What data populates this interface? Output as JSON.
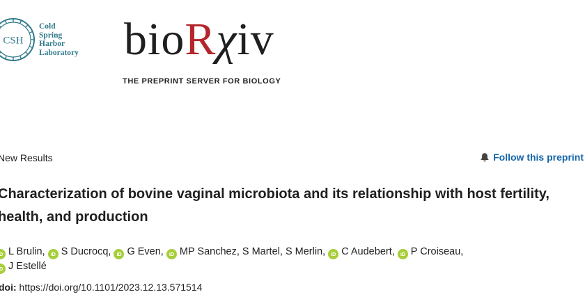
{
  "header": {
    "csh_logo": {
      "seal_text": "CSH",
      "lines": [
        "Cold",
        "Spring",
        "Harbor",
        "Laboratory"
      ]
    },
    "biorxiv_logo": {
      "part1": "bio",
      "part2": "R",
      "part3": "χ",
      "part4": "iv"
    },
    "tagline": "THE PREPRINT SERVER FOR BIOLOGY",
    "colors": {
      "teal": "#2f7a8c",
      "brand_red": "#b3262b",
      "link_blue": "#1565a8",
      "orcid_green": "#a6ce39"
    }
  },
  "article": {
    "category": "New Results",
    "follow_label": "Follow this preprint",
    "title": "Characterization of bovine vaginal microbiota and its relationship with host fertility, health, and production",
    "orcid_icon_text": "iD",
    "authors": [
      {
        "name": "L Brulin,",
        "orcid": true
      },
      {
        "name": "S Ducrocq,",
        "orcid": true
      },
      {
        "name": "G Even,",
        "orcid": true
      },
      {
        "name": "MP Sanchez,",
        "orcid": true
      },
      {
        "name": "S Martel,",
        "orcid": false
      },
      {
        "name": "S Merlin,",
        "orcid": false
      },
      {
        "name": "C Audebert,",
        "orcid": true
      },
      {
        "name": "P Croiseau,",
        "orcid": true
      },
      {
        "name": "J Estellé",
        "orcid": true
      }
    ],
    "doi_label": "doi:",
    "doi_url": "https://doi.org/10.1101/2023.12.13.571514"
  }
}
